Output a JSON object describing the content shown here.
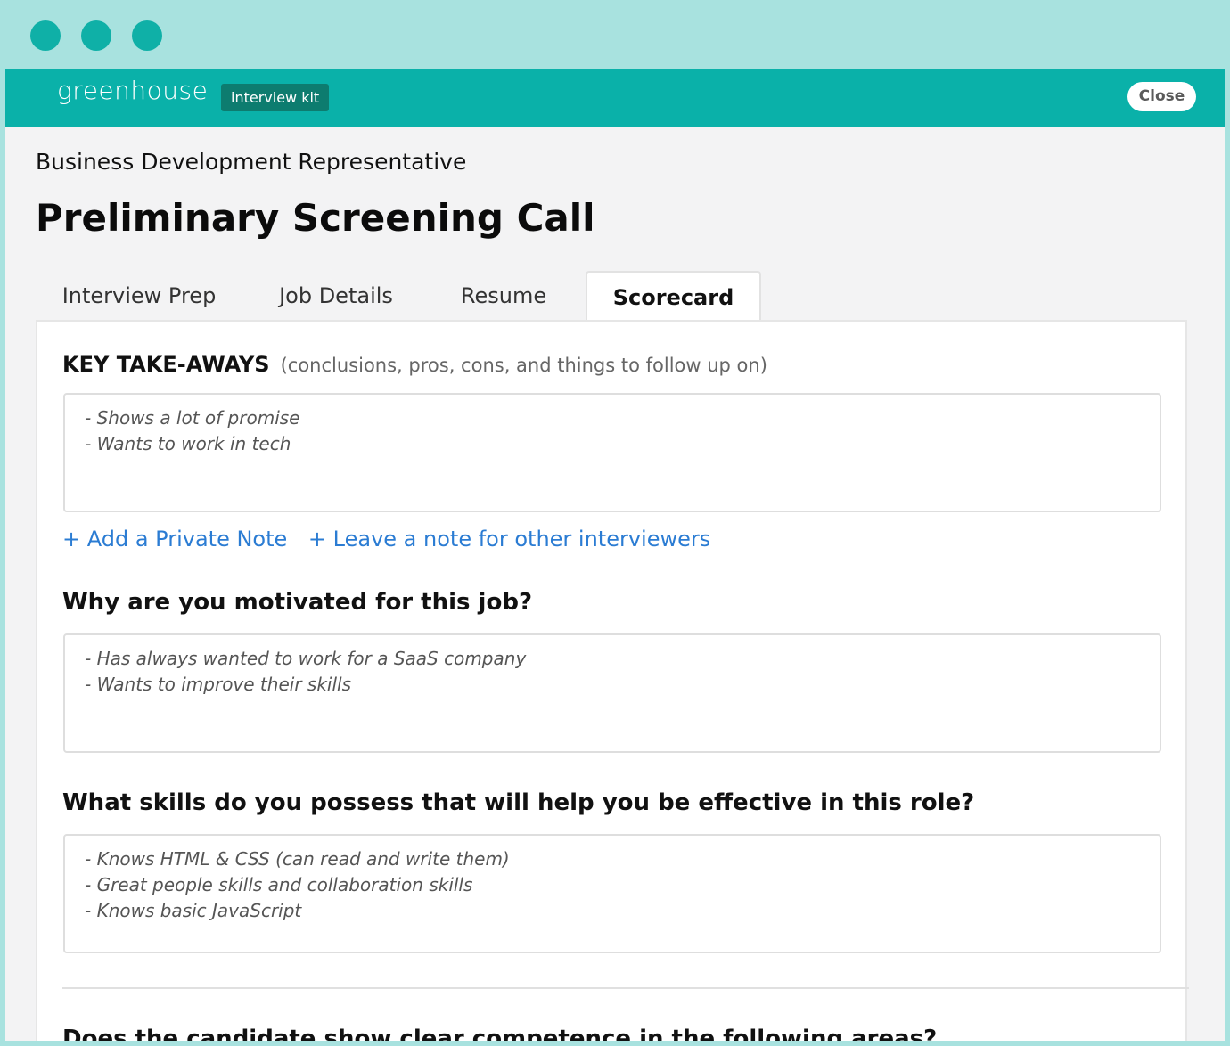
{
  "header": {
    "brand": "greenhouse",
    "badge": "interview kit",
    "close_label": "Close"
  },
  "page": {
    "subtitle": "Business Development Representative",
    "title": "Preliminary Screening Call"
  },
  "tabs": [
    {
      "label": "Interview Prep",
      "active": false
    },
    {
      "label": "Job Details",
      "active": false
    },
    {
      "label": "Resume",
      "active": false
    },
    {
      "label": "Scorecard",
      "active": true
    }
  ],
  "scorecard": {
    "key_takeaways": {
      "label": "KEY TAKE-AWAYS",
      "hint": "(conclusions, pros, cons, and things to follow up on)",
      "lines": [
        "- Shows a lot of promise",
        "- Wants to work in tech"
      ]
    },
    "links": {
      "private_note": "+ Add a Private Note",
      "other_interviewers": "+ Leave a note for other interviewers"
    },
    "q1": {
      "question": "Why are you motivated for this job?",
      "lines": [
        "- Has always wanted to work for a SaaS company",
        "- Wants to improve their skills"
      ]
    },
    "q2": {
      "question": "What skills do you possess that will help you be effective in this role?",
      "lines": [
        "- Knows HTML & CSS (can read and write them)",
        "- Great people skills and collaboration skills",
        "- Knows basic JavaScript"
      ]
    },
    "competence_heading": "Does the candidate show clear competence in the following areas?"
  },
  "colors": {
    "frame_bg": "#a8e2df",
    "traffic_dot": "#0fb0a7",
    "topbar": "#0ab1a9",
    "badge": "#0d7c6f",
    "link": "#2b7cd3"
  }
}
